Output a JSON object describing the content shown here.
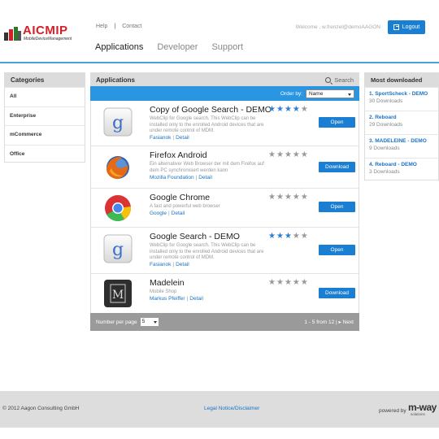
{
  "header": {
    "logo_title": "AICMIP",
    "logo_subtitle": "MobileDeviceManagement",
    "top_links": [
      "Help",
      "Contact"
    ],
    "nav": [
      {
        "label": "Applications",
        "active": true
      },
      {
        "label": "Developer",
        "active": false
      },
      {
        "label": "Support",
        "active": false
      }
    ],
    "welcome": "Welcome , w.frenzel@demoAAGON",
    "logout_label": "Logout"
  },
  "categories": {
    "title": "Categories",
    "items": [
      "All",
      "Enterprise",
      "mCommerce",
      "Office"
    ]
  },
  "applications": {
    "title": "Applications",
    "search_label": "Search",
    "order_by_label": "Order by:",
    "order_by_value": "Name",
    "items": [
      {
        "name": "Copy of Google Search - DEMO",
        "icon": "google-search-icon",
        "description": "WebClip for Google search. This WebClip can be installed only to the enrolled Android devices that are under remote control of MDM.",
        "vendor": "Fasianok",
        "detail": "Detail",
        "rating": 4,
        "action": "Open"
      },
      {
        "name": "Firefox Android",
        "icon": "firefox-icon",
        "description": "Ein alternativer Web Browser der mit dem Firefox auf dem PC synchronisiert werden kann",
        "vendor": "Mozilla Foundation",
        "detail": "Detail",
        "rating": 0,
        "action": "Download"
      },
      {
        "name": "Google Chrome",
        "icon": "chrome-icon",
        "description": "A fast and powerful web browser",
        "vendor": "Google",
        "detail": "Detail",
        "rating": 0,
        "action": "Open"
      },
      {
        "name": "Google Search - DEMO",
        "icon": "google-search-icon",
        "description": "WebClip for Google search. This WebClip can be installed only to the enrolled Android devices that are under remote control of MDM.",
        "vendor": "Fasianok",
        "detail": "Detail",
        "rating": 3,
        "action": "Open"
      },
      {
        "name": "Madelein",
        "icon": "madelein-icon",
        "description": "Mobile Shop",
        "vendor": "Markus Pfeiffer",
        "detail": "Detail",
        "rating": 0,
        "action": "Download"
      }
    ],
    "per_page_label": "Number per page",
    "per_page_value": "5",
    "range_text": "1 - 5 from 12 |",
    "next_label": "Next"
  },
  "most_downloaded": {
    "title": "Most downloaded",
    "items": [
      {
        "title": "1. SportScheck - DEMO",
        "count": "30 Downloads"
      },
      {
        "title": "2. Reboard",
        "count": "29 Downloads"
      },
      {
        "title": "3. MADELEINE - DEMO",
        "count": "9 Downloads"
      },
      {
        "title": "4. Reboard - DEMO",
        "count": "3 Downloads"
      }
    ]
  },
  "footer": {
    "copyright": "© 2012 Aagon Consulting GmbH",
    "legal": "Legal Notice/Disclaimer",
    "powered_by": "powered by",
    "brand": "m-way",
    "brand_sub": "solutions"
  },
  "colors": {
    "accent": "#1a7fd2",
    "header_line": "#49a3dc",
    "logo_red": "#d32027"
  }
}
